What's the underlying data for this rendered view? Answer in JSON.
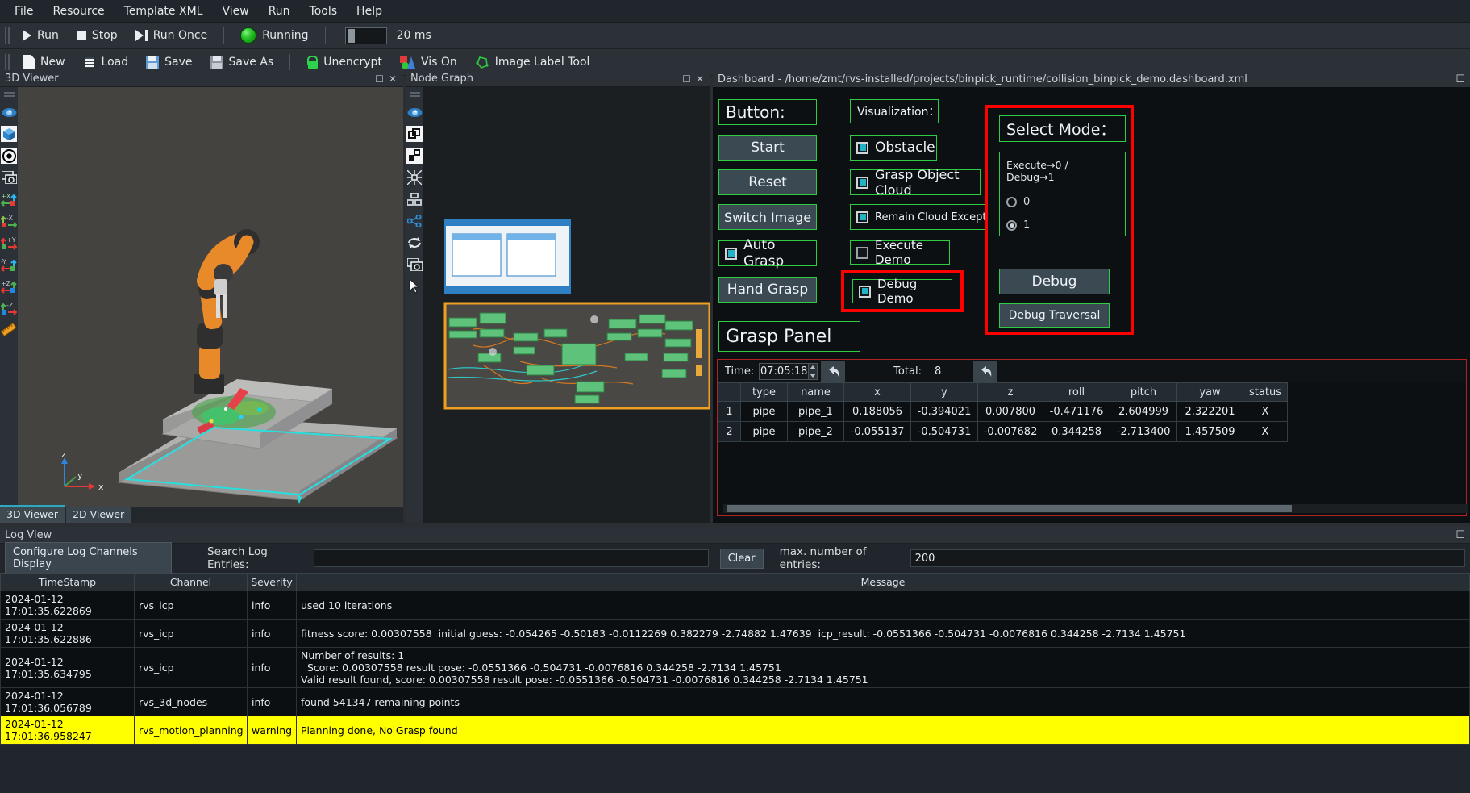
{
  "menubar": {
    "items": [
      "File",
      "Resource",
      "Template XML",
      "View",
      "Run",
      "Tools",
      "Help"
    ]
  },
  "toolbar_run": {
    "run": "Run",
    "stop": "Stop",
    "run_once": "Run Once",
    "status": "Running",
    "interval": "20 ms"
  },
  "toolbar_file": {
    "new": "New",
    "load": "Load",
    "save": "Save",
    "save_as": "Save As",
    "unencrypt": "Unencrypt",
    "vis_on": "Vis On",
    "image_label_tool": "Image Label Tool"
  },
  "viewer3d": {
    "title": "3D Viewer",
    "tabs": [
      {
        "label": "3D Viewer",
        "active": true
      },
      {
        "label": "2D Viewer",
        "active": false
      }
    ],
    "axis_labels": {
      "x": "x",
      "y": "y",
      "z": "z"
    },
    "tool_icons": [
      "eye-icon",
      "cube-icon",
      "target-icon",
      "screenshot-icon",
      "axis-plus-x-icon",
      "axis-minus-x-icon",
      "axis-plus-y-icon",
      "axis-minus-y-icon",
      "axis-plus-z-icon",
      "axis-minus-z-icon",
      "ruler-icon"
    ],
    "axis_buttons": [
      "+X",
      "-X",
      "+Y",
      "-Y",
      "+Z",
      "-Z"
    ]
  },
  "nodegraph": {
    "title": "Node Graph",
    "tool_icons": [
      "eye-icon",
      "group-icon",
      "ungroup-icon",
      "collapse-icon",
      "layout-icon",
      "share-icon",
      "refresh-icon",
      "screenshot-icon",
      "cursor-icon"
    ]
  },
  "dashboard": {
    "title": "Dashboard - /home/zmt/rvs-installed/projects/binpick_runtime/collision_binpick_demo.dashboard.xml",
    "column1": {
      "header": "Button:",
      "buttons": [
        "Start",
        "Reset",
        "Switch Image",
        "Hand Grasp"
      ],
      "auto_grasp": {
        "label": "Auto Grasp",
        "checked": true
      },
      "grasp_panel_header": "Grasp Panel"
    },
    "column2": {
      "header": "Visualization：",
      "checkboxes": [
        {
          "label": "Obstacle",
          "checked": true
        },
        {
          "label": "Grasp Object Cloud",
          "checked": true
        },
        {
          "label": "Remain Cloud Except Items",
          "checked": true
        },
        {
          "label": "Execute Demo",
          "checked": false
        },
        {
          "label": "Debug Demo",
          "checked": true,
          "highlighted": true
        }
      ]
    },
    "column3": {
      "header": "Select Mode：",
      "mode_hint": "Execute→0 / Debug→1",
      "radios": [
        {
          "label": "0",
          "selected": false
        },
        {
          "label": "1",
          "selected": true
        }
      ],
      "buttons": [
        "Debug",
        "Debug Traversal"
      ]
    },
    "grasp_panel": {
      "time_label": "Time:",
      "time_value": "07:05:18",
      "total_label": "Total:",
      "total_value": "8",
      "columns": [
        "",
        "type",
        "name",
        "x",
        "y",
        "z",
        "roll",
        "pitch",
        "yaw",
        "status"
      ],
      "rows": [
        {
          "index": "1",
          "type": "pipe",
          "name": "pipe_1",
          "x": "0.188056",
          "y": "-0.394021",
          "z": "0.007800",
          "roll": "-0.471176",
          "pitch": "2.604999",
          "yaw": "2.322201",
          "status": "X"
        },
        {
          "index": "2",
          "type": "pipe",
          "name": "pipe_2",
          "x": "-0.055137",
          "y": "-0.504731",
          "z": "-0.007682",
          "roll": "0.344258",
          "pitch": "-2.713400",
          "yaw": "1.457509",
          "status": "X"
        }
      ]
    }
  },
  "logview": {
    "title": "Log View",
    "configure_button": "Configure Log Channels Display",
    "search_label": "Search Log Entries:",
    "search_value": "",
    "search_placeholder": "",
    "clear_button": "Clear",
    "max_entries_label": "max. number of entries:",
    "max_entries_value": "200",
    "columns": [
      "TimeStamp",
      "Channel",
      "Severity",
      "Message"
    ],
    "rows": [
      {
        "timestamp": "2024-01-12 17:01:35.622869",
        "channel": "rvs_icp",
        "severity": "info",
        "message": "used 10 iterations",
        "warn": false
      },
      {
        "timestamp": "2024-01-12 17:01:35.622886",
        "channel": "rvs_icp",
        "severity": "info",
        "message": "fitness score: 0.00307558  initial guess: -0.054265 -0.50183 -0.0112269 0.382279 -2.74882 1.47639  icp_result: -0.0551366 -0.504731 -0.0076816 0.344258 -2.7134 1.45751",
        "warn": false
      },
      {
        "timestamp": "2024-01-12 17:01:35.634795",
        "channel": "rvs_icp",
        "severity": "info",
        "message": "Number of results: 1\n  Score: 0.00307558 result pose: -0.0551366 -0.504731 -0.0076816 0.344258 -2.7134 1.45751\nValid result found, score: 0.00307558 result pose: -0.0551366 -0.504731 -0.0076816 0.344258 -2.7134 1.45751",
        "warn": false
      },
      {
        "timestamp": "2024-01-12 17:01:36.056789",
        "channel": "rvs_3d_nodes",
        "severity": "info",
        "message": "found 541347 remaining points",
        "warn": false
      },
      {
        "timestamp": "2024-01-12 17:01:36.958247",
        "channel": "rvs_motion_planning",
        "severity": "warning",
        "message": "Planning done, No Grasp found",
        "warn": true
      }
    ]
  },
  "colors": {
    "accent_green": "#2ecc40",
    "highlight_red": "#ff0000",
    "warning_yellow": "#ffff00",
    "panel_bg": "#20262b",
    "dashboard_bg": "#0d1012",
    "checkbox_on": "#21b4c8"
  }
}
